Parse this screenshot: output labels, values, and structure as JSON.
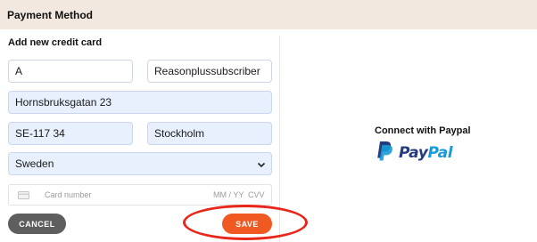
{
  "header": {
    "title": "Payment Method"
  },
  "form": {
    "title": "Add new credit card",
    "first_name": "A",
    "last_name": "Reasonplussubscriber",
    "street": "Hornsbruksgatan 23",
    "zip": "SE-117 34",
    "city": "Stockholm",
    "country": "Sweden",
    "card": {
      "number_placeholder": "Card number",
      "expiry_placeholder": "MM / YY",
      "cvv_placeholder": "CVV"
    },
    "cancel_label": "CANCEL",
    "save_label": "SAVE"
  },
  "paypal": {
    "title": "Connect with Paypal",
    "logo_text_pay": "Pay",
    "logo_text_pal": "Pal"
  },
  "colors": {
    "header_bg": "#f2e8e0",
    "save_button": "#f05a22",
    "cancel_button": "#5e5e5e",
    "highlight": "#e8261a",
    "paypal_dark": "#253b80",
    "paypal_light": "#179bd7"
  },
  "icons": [
    "card-icon",
    "chevron-down-icon",
    "paypal-logo-icon"
  ]
}
